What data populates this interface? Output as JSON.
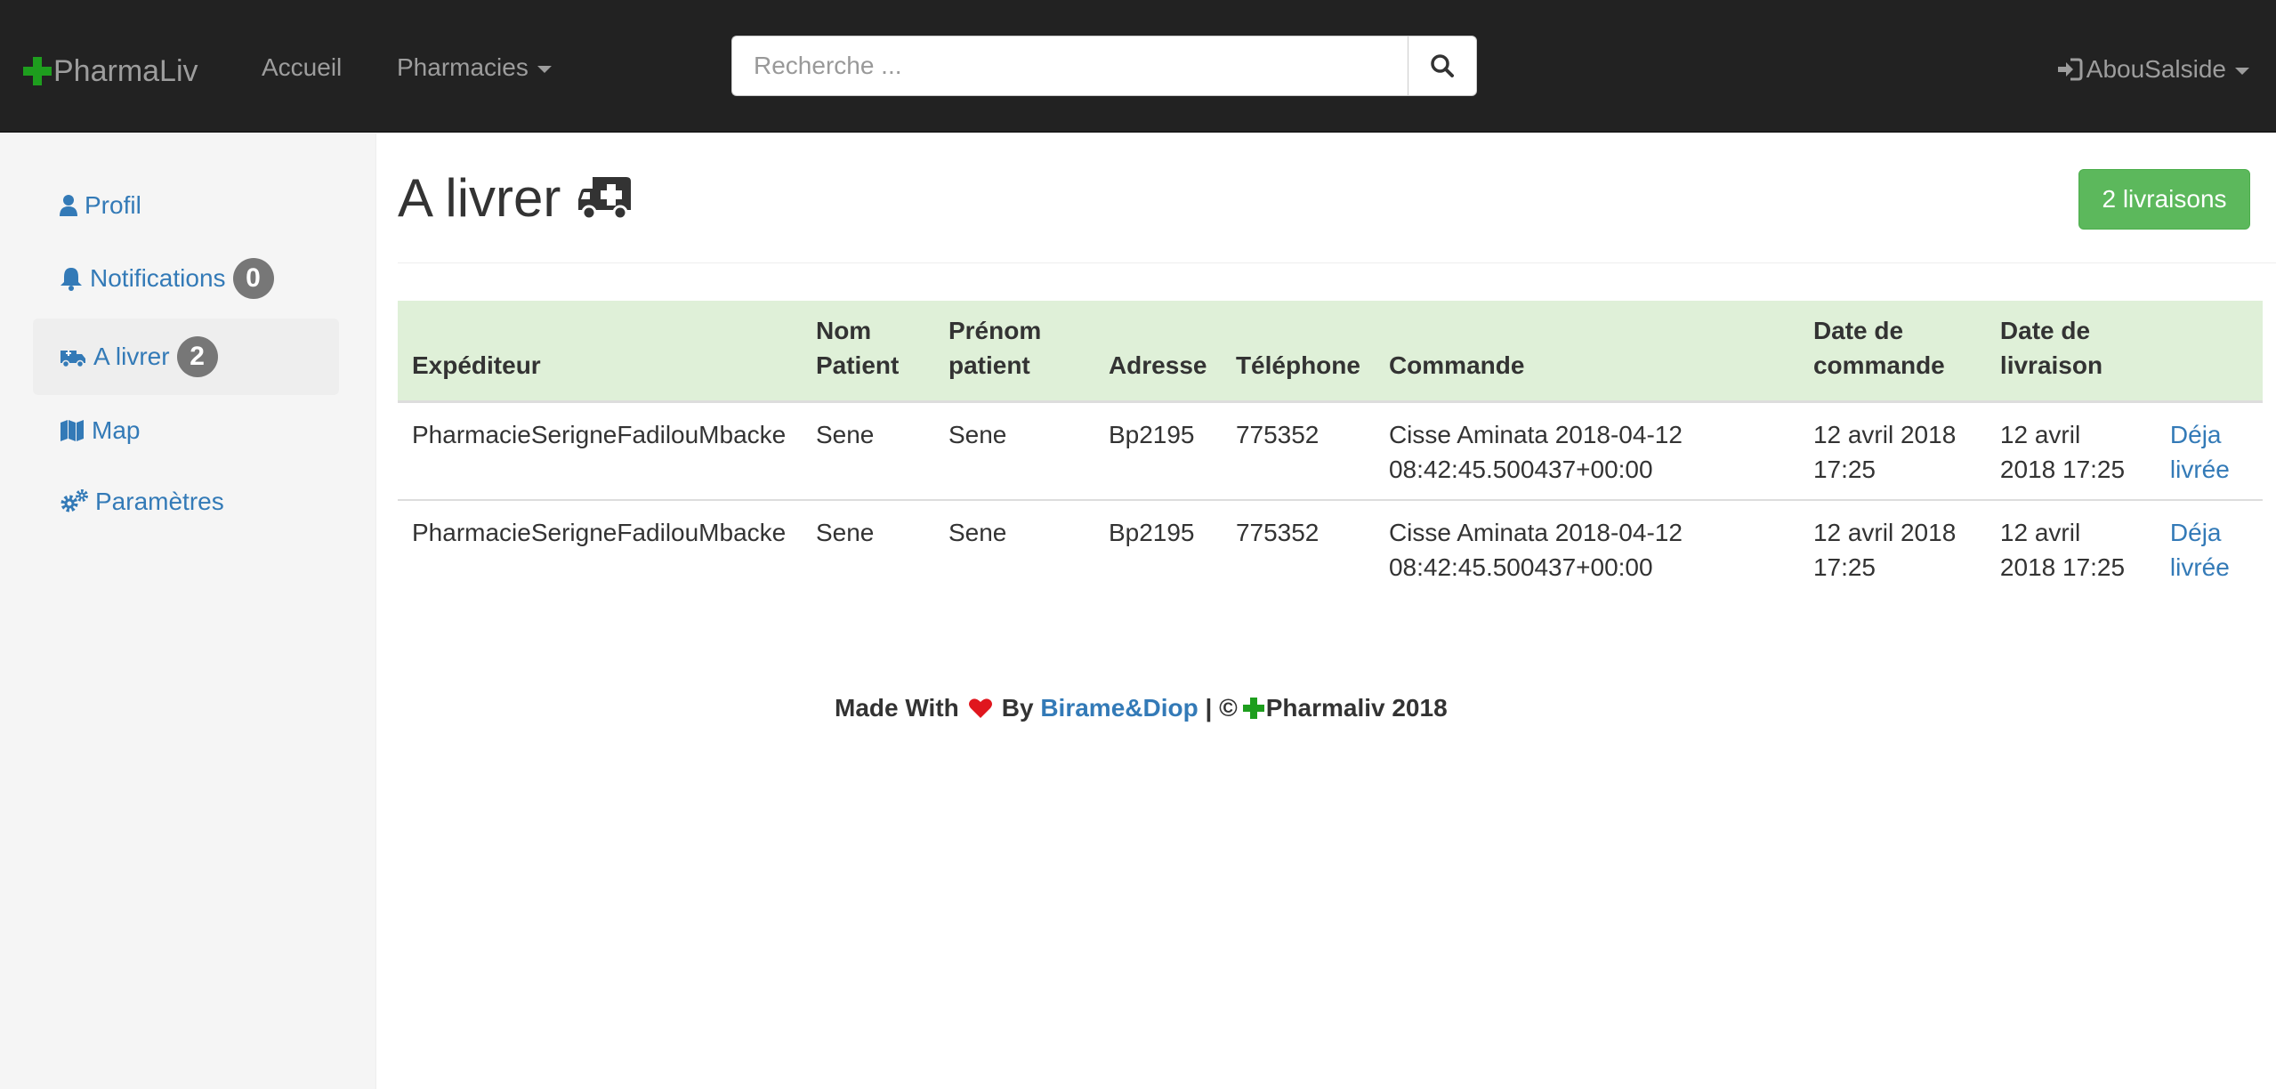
{
  "navbar": {
    "brand": "PharmaLiv",
    "links": [
      "Accueil",
      "Pharmacies"
    ],
    "search_placeholder": "Recherche ...",
    "user": "AbouSalside"
  },
  "sidebar": {
    "items": [
      {
        "label": "Profil",
        "icon": "user-icon"
      },
      {
        "label": "Notifications",
        "icon": "bell-icon",
        "badge": "0"
      },
      {
        "label": "A livrer",
        "icon": "ambulance-icon",
        "badge": "2",
        "active": true
      },
      {
        "label": "Map",
        "icon": "map-icon"
      },
      {
        "label": "Paramètres",
        "icon": "gears-icon"
      }
    ]
  },
  "main": {
    "title": "A livrer",
    "title_icon": "ambulance-icon",
    "count_label": "2 livraisons",
    "table": {
      "headers": [
        "Expéditeur",
        "Nom Patient",
        "Prénom patient",
        "Adresse",
        "Téléphone",
        "Commande",
        "Date de commande",
        "Date de livraison",
        ""
      ],
      "rows": [
        [
          "PharmacieSerigneFadilouMbacke",
          "Sene",
          "Sene",
          "Bp2195",
          "775352",
          "Cisse Aminata 2018-04-12 08:42:45.500437+00:00",
          "12 avril 2018 17:25",
          "12 avril 2018 17:25",
          "Déja livrée"
        ],
        [
          "PharmacieSerigneFadilouMbacke",
          "Sene",
          "Sene",
          "Bp2195",
          "775352",
          "Cisse Aminata 2018-04-12 08:42:45.500437+00:00",
          "12 avril 2018 17:25",
          "12 avril 2018 17:25",
          "Déja livrée"
        ]
      ]
    }
  },
  "footer": {
    "made_with": "Made With",
    "by": "By",
    "authors": "Birame&Diop",
    "separator": "| ©",
    "brand": "Pharmaliv 2018"
  },
  "colors": {
    "navbar_bg": "#222222",
    "link": "#337ab7",
    "success": "#5cb85c",
    "header_row": "#dff0d8",
    "brand_green": "#1e9e1e",
    "heart": "#e0161e"
  }
}
